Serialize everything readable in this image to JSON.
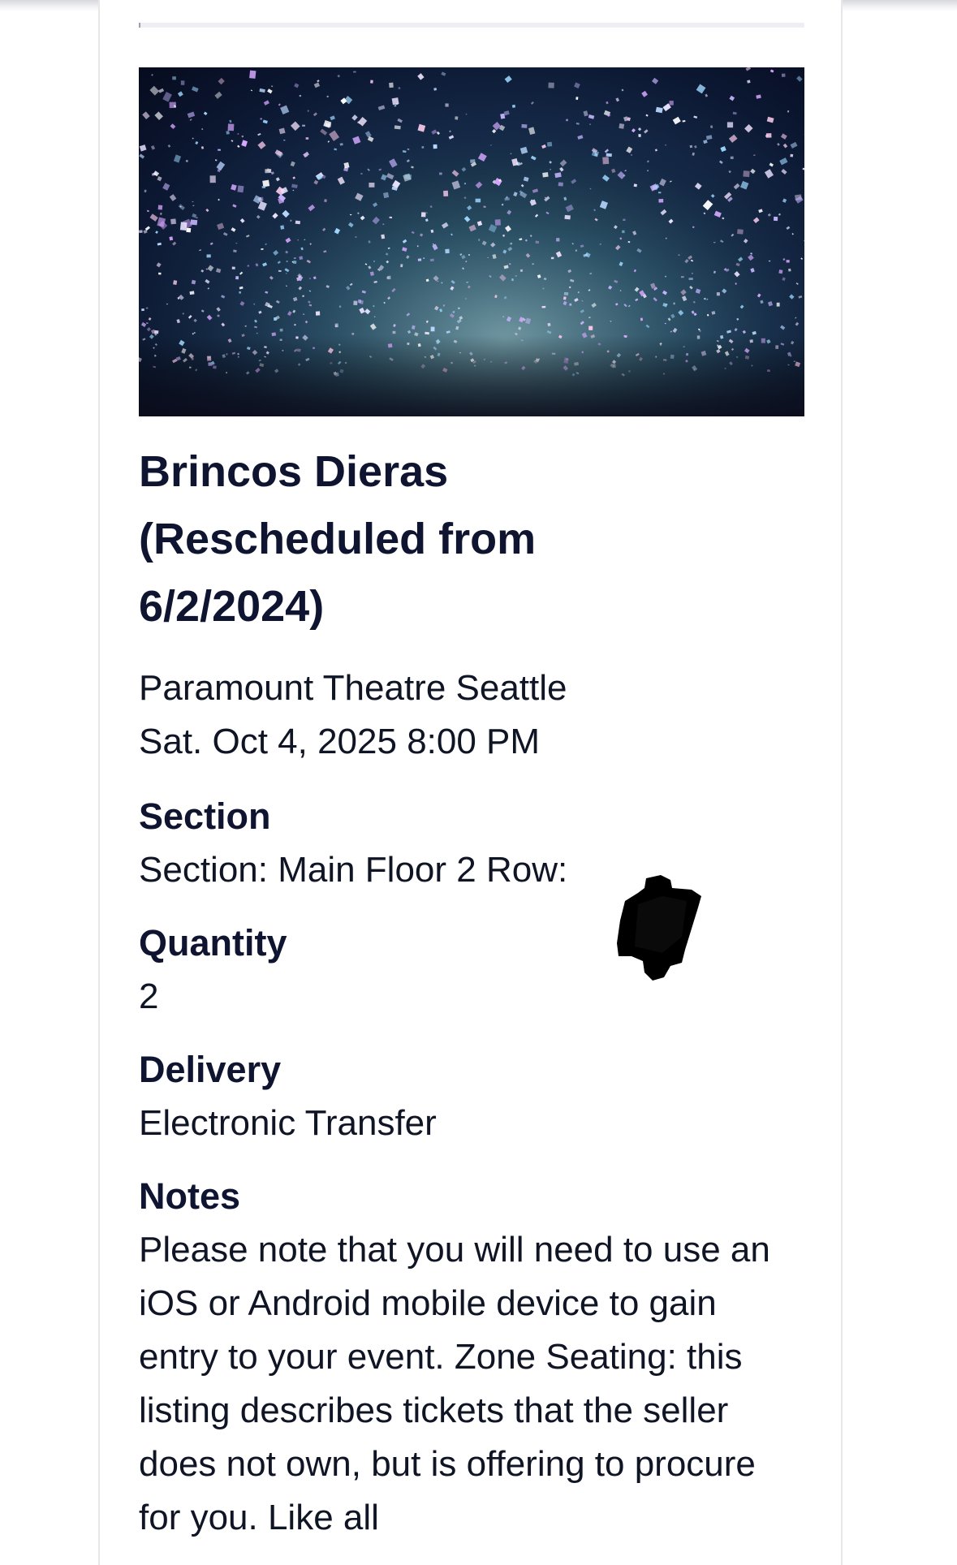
{
  "event": {
    "title": "Brincos Dieras (Rescheduled from 6/2/2024)",
    "venue": "Paramount Theatre Seattle",
    "datetime": "Sat. Oct 4, 2025 8:00 PM"
  },
  "details": {
    "section_label": "Section",
    "section_value": "Section: Main Floor 2 Row:",
    "quantity_label": "Quantity",
    "quantity_value": "2",
    "delivery_label": "Delivery",
    "delivery_value": "Electronic Transfer",
    "notes_label": "Notes",
    "notes_value": "Please note that you will need to use an iOS or Android mobile device to gain entry to your event. Zone Seating: this listing describes tickets that the seller does not own, but is offering to procure for you. Like all"
  },
  "hero_image": {
    "icon": "confetti-concert-photo"
  },
  "colors": {
    "heading": "#0f1530",
    "body_text": "#101525",
    "card_border": "#e7e7ea"
  }
}
